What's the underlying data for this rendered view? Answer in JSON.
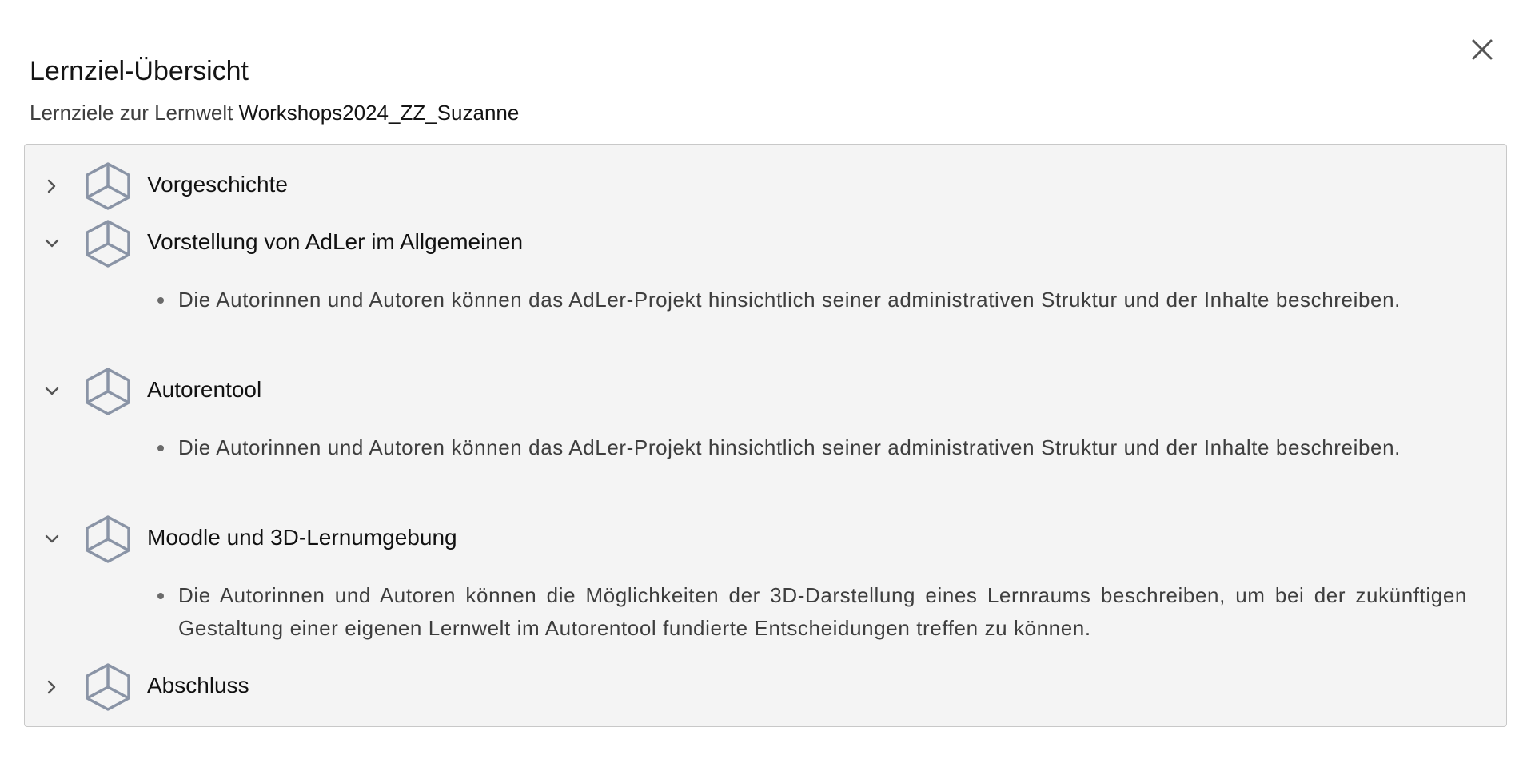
{
  "dialog": {
    "title": "Lernziel-Übersicht",
    "subtitle_prefix": "Lernziele zur Lernwelt",
    "world_name": "Workshops2024_ZZ_Suzanne",
    "close_icon": "close-icon"
  },
  "spaces": [
    {
      "title": "Vorgeschichte",
      "expanded": false,
      "icon": "cube-icon",
      "goals": []
    },
    {
      "title": "Vorstellung von AdLer im Allgemeinen",
      "expanded": true,
      "icon": "cube-icon",
      "goals": [
        "Die Autorinnen und Autoren können das AdLer-Projekt hinsichtlich seiner administrativen Struktur und der Inhalte beschreiben."
      ]
    },
    {
      "title": "Autorentool",
      "expanded": true,
      "icon": "cube-icon",
      "goals": [
        "Die Autorinnen und Autoren können das AdLer-Projekt hinsichtlich seiner administrativen Struktur und der Inhalte beschreiben."
      ]
    },
    {
      "title": "Moodle und 3D-Lernumgebung",
      "expanded": true,
      "icon": "cube-icon",
      "goals": [
        "Die Autorinnen und Autoren können die Möglichkeiten der 3D-Darstellung eines Lernraums beschreiben, um bei der zukünftigen Gestaltung einer eigenen Lernwelt im Autorentool fundierte Entscheidungen treffen zu können."
      ]
    },
    {
      "title": "Abschluss",
      "expanded": false,
      "icon": "cube-icon",
      "goals": []
    }
  ],
  "colors": {
    "panel_bg": "#f4f4f4",
    "icon_stroke": "#8a94a6"
  }
}
